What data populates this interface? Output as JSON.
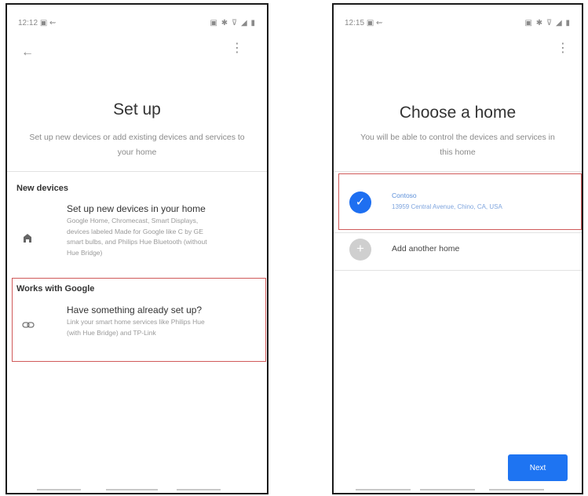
{
  "left": {
    "status": {
      "time": "12:12",
      "left_icons": "▣ ⇜",
      "right_icons": "▣ ✱ ⊽ ◢ ▮"
    },
    "title": "Set up",
    "subtitle": "Set up new devices or add existing devices and services to your home",
    "new_devices": {
      "label": "New devices",
      "title": "Set up new devices in your home",
      "desc": "Google Home, Chromecast, Smart Displays, devices labeled Made for Google like C by GE smart bulbs, and Philips Hue Bluetooth (without Hue Bridge)"
    },
    "works_with": {
      "label": "Works with Google",
      "title": "Have something already set up?",
      "desc": "Link your smart home services like Philips Hue (with Hue Bridge) and TP-Link"
    }
  },
  "right": {
    "status": {
      "time": "12:15",
      "left_icons": "▣ ⇜",
      "right_icons": "▣ ✱ ⊽ ◢ ▮"
    },
    "title": "Choose a home",
    "subtitle": "You will be able to control the devices and services in this home",
    "home": {
      "name": "Contoso",
      "address": "13959 Central Avenue, Chino, CA, USA"
    },
    "add_home": "Add another home",
    "next": "Next"
  },
  "colors": {
    "accent": "#1e74f2",
    "highlight": "#d05a5a"
  },
  "icons": {
    "back": "back-arrow-icon",
    "menu": "more-vert-icon",
    "home": "home-icon",
    "link": "link-icon",
    "check": "check-icon",
    "add": "add-icon"
  }
}
